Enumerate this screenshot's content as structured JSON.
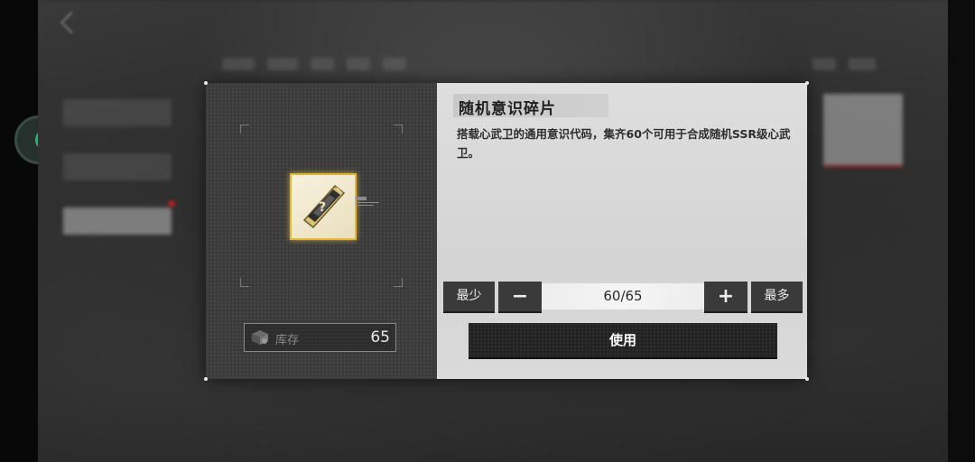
{
  "item": {
    "name": "随机意识碎片",
    "description": "搭载心武卫的通用意识代码，集齐60个可用于合成随机SSR级心武卫。",
    "rarity_color": "#e4b834",
    "icon": "diamond-fragment-icon"
  },
  "stock": {
    "label": "库存",
    "value": "65",
    "icon": "storage-box-icon"
  },
  "quantity": {
    "min_label": "最少",
    "max_label": "最多",
    "minus_symbol": "−",
    "plus_symbol": "+",
    "display": "60/65"
  },
  "actions": {
    "use_label": "使用"
  },
  "colors": {
    "accent_green": "#1fb87a",
    "dark_button": "#3a3a3a",
    "panel_light": "#d8d8d8",
    "panel_dark": "#3b3b3b"
  }
}
